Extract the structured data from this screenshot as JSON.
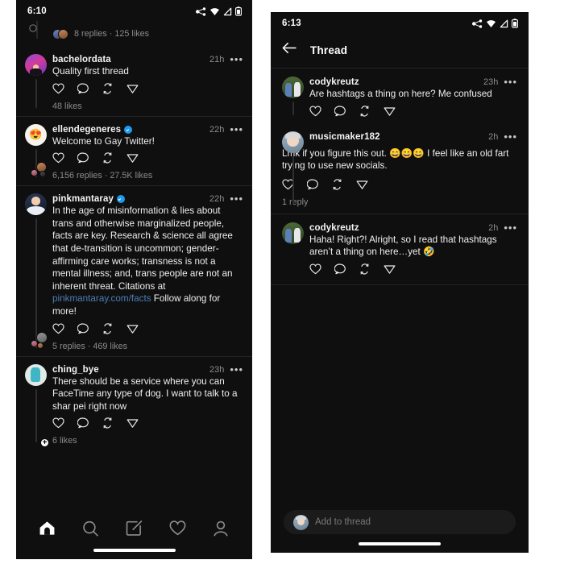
{
  "left_phone": {
    "status": {
      "time": "6:10",
      "icons": [
        "share-network-icon",
        "wifi-icon",
        "signal-icon",
        "battery-icon"
      ]
    },
    "replies_strip": {
      "label": "8 replies · 125 likes"
    },
    "posts": [
      {
        "username": "bachelordata",
        "verified": false,
        "time": "21h",
        "text": "Quality first thread",
        "stat": "48 likes",
        "avatar": "av-bachelordata",
        "has_plus_badge": false,
        "wide_text": false
      },
      {
        "username": "ellendegeneres",
        "verified": true,
        "time": "22h",
        "text": "Welcome to Gay Twitter!",
        "stat": "6,156 replies · 27.5K likes",
        "avatar": "av-ellen",
        "has_plus_badge": false,
        "wide_text": false
      },
      {
        "username": "pinkmantaray",
        "verified": true,
        "time": "22h",
        "text_pre": "In the age of misinformation & lies about trans and otherwise marginalized people, facts are key. Research & science all agree that de-transition is uncommon; gender-affirming care works; transness is not a mental illness; and, trans people are not an inherent threat. Citations at ",
        "link": "pinkmantaray.com/facts",
        "text_post": " Follow along for more!",
        "stat": "5 replies · 469 likes",
        "avatar": "av-pink",
        "has_plus_badge": false,
        "wide_text": false
      },
      {
        "username": "ching_bye",
        "verified": false,
        "time": "23h",
        "text": "There should be a service where you can FaceTime any type of dog. I want to talk to a shar pei right now",
        "stat": "6 likes",
        "avatar": "av-ching",
        "has_plus_badge": true,
        "wide_text": false
      }
    ],
    "actions": [
      "like-heart-icon",
      "comment-icon",
      "repost-icon",
      "share-icon"
    ],
    "bottom_nav": [
      {
        "name": "home",
        "icon": "home-icon",
        "active": true
      },
      {
        "name": "search",
        "icon": "search-icon",
        "active": false
      },
      {
        "name": "compose",
        "icon": "compose-icon",
        "active": false
      },
      {
        "name": "activity",
        "icon": "heart-icon",
        "active": false
      },
      {
        "name": "profile",
        "icon": "person-icon",
        "active": false
      }
    ]
  },
  "right_phone": {
    "status": {
      "time": "6:13",
      "icons": [
        "share-network-icon",
        "wifi-icon",
        "signal-icon",
        "battery-icon"
      ]
    },
    "header": {
      "back": "back-arrow-icon",
      "title": "Thread"
    },
    "posts": [
      {
        "username": "codykreutz",
        "verified": false,
        "time": "23h",
        "text": "Are hashtags a thing on here? Me confused",
        "stat": "",
        "avatar": "av-cody",
        "wide_text": false
      },
      {
        "username": "musicmaker182",
        "verified": false,
        "time": "2h",
        "text": "Lmk if you figure this out. 😄😄😄 I feel like an old fart trying to use new socials.",
        "stat": "1 reply",
        "avatar": "av-music",
        "wide_text": true
      },
      {
        "username": "codykreutz",
        "verified": false,
        "time": "2h",
        "text": "Haha! Right?! Alright, so I read that hashtags aren’t a thing on here…yet 🤣",
        "stat": "",
        "avatar": "av-cody",
        "wide_text": false
      }
    ],
    "composer": {
      "placeholder": "Add to thread",
      "avatar": "av-music"
    }
  },
  "colors": {
    "background": "#0f0f0f",
    "page": "#ffffff",
    "text_primary": "#efefef",
    "text_muted": "#8b8b8b",
    "link": "#4a7fb5",
    "verified_blue": "#1d9bf0",
    "divider": "#232323",
    "thread_line": "#2e2e2e",
    "composer_bg": "#1b1b1b"
  }
}
